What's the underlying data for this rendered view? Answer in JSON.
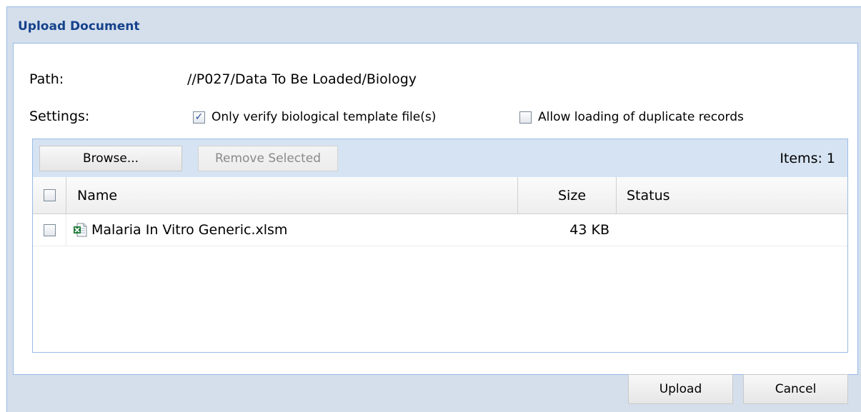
{
  "dialog": {
    "title": "Upload Document"
  },
  "path": {
    "label": "Path:",
    "value": "//P027/Data To Be Loaded/Biology"
  },
  "settings": {
    "label": "Settings:",
    "verify_only": {
      "label": "Only verify biological template file(s)",
      "checked": true
    },
    "allow_duplicates": {
      "label": "Allow loading of duplicate records",
      "checked": false
    }
  },
  "toolbar": {
    "browse_label": "Browse...",
    "remove_label": "Remove Selected",
    "items_count": "Items: 1"
  },
  "grid": {
    "columns": {
      "name": "Name",
      "size": "Size",
      "status": "Status"
    },
    "rows": [
      {
        "name": "Malaria In Vitro Generic.xlsm",
        "size": "43 KB",
        "status": "",
        "icon": "excel-file-icon",
        "checked": false
      }
    ]
  },
  "footer": {
    "upload_label": "Upload",
    "cancel_label": "Cancel"
  },
  "colors": {
    "title": "#15428b",
    "frame": "#d5dfec",
    "border": "#99bbe8",
    "toolbar": "#d6e3f2",
    "check": "#2a4f9e"
  }
}
